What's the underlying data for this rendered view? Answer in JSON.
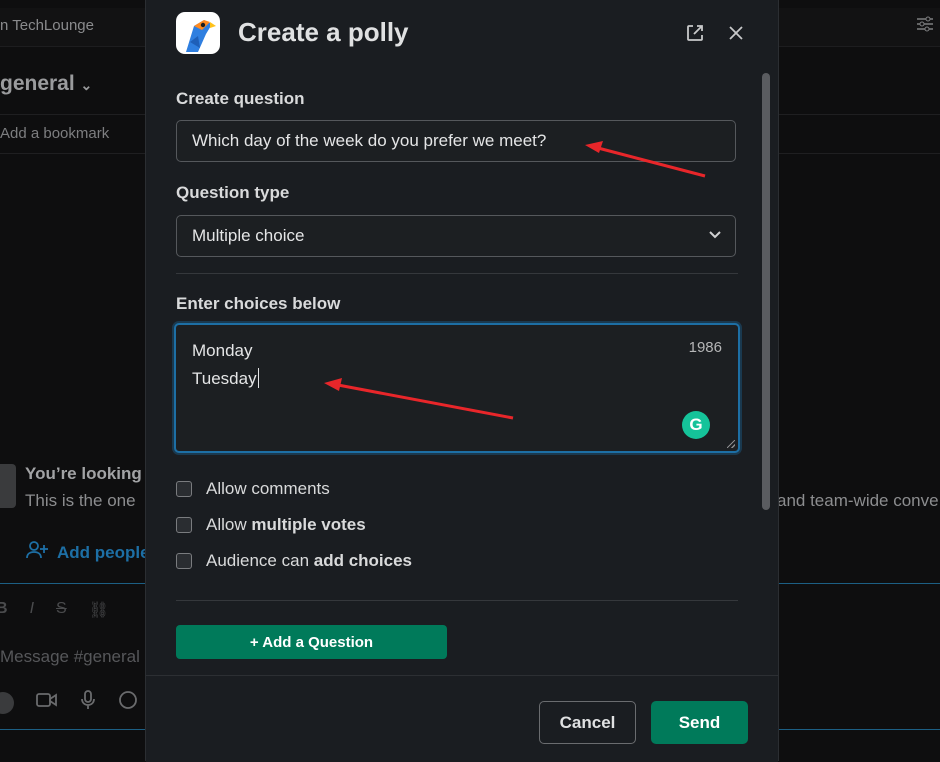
{
  "background": {
    "workspace_name": "n TechLounge",
    "channel_name": "general",
    "bookmark_text": "Add a bookmark",
    "intro_title": "You’re looking",
    "intro_text": "This is the one",
    "intro_text_right": "and team-wide conve",
    "add_people_label": "Add people",
    "message_placeholder": "Message #general"
  },
  "modal": {
    "title": "Create a polly",
    "question_label": "Create question",
    "question_value": "Which day of the week do you prefer we meet?",
    "type_label": "Question type",
    "type_value": "Multiple choice",
    "choices_label": "Enter choices below",
    "choices": [
      "Monday",
      "Tuesday"
    ],
    "char_counter": "1986",
    "grammarly_letter": "G",
    "options": [
      {
        "prefix": "Allow comments",
        "bold": ""
      },
      {
        "prefix": "Allow ",
        "bold": "multiple votes"
      },
      {
        "prefix": "Audience can ",
        "bold": "add choices"
      }
    ],
    "add_question_label": "+ Add a Question",
    "cancel_label": "Cancel",
    "send_label": "Send"
  },
  "colors": {
    "accent_green": "#007a5a",
    "focus_blue": "#1d6fa5",
    "annotation_red": "#e8262a",
    "modal_bg": "#1a1d21"
  },
  "icons": [
    "polly-parrot-logo",
    "popout-icon",
    "close-icon",
    "chevron-down-icon",
    "grammarly-icon",
    "filter-icon",
    "add-people-icon"
  ]
}
